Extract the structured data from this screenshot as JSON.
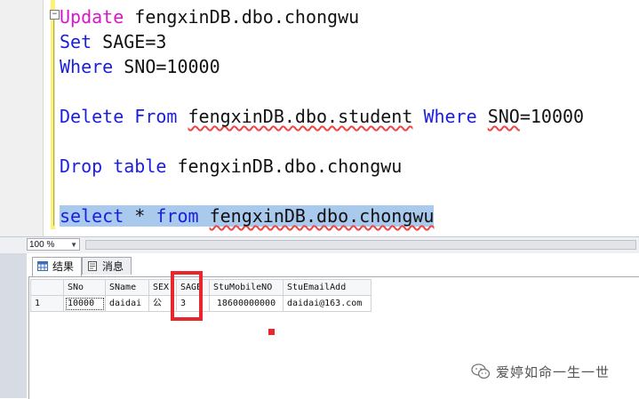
{
  "editor": {
    "lines": [
      {
        "k1": "Update",
        "t1": " fengxinDB.dbo.chongwu"
      },
      {
        "k1": "Set",
        "t1": " SAGE=3"
      },
      {
        "k1": "Where",
        "t1": " SNO=10000"
      },
      {
        "k1": "Delete",
        "t1": " ",
        "k2": "From",
        "t2": " ",
        "sq1": "fengxinDB.dbo.student",
        "t3": " ",
        "k3": "Where",
        "t4": " ",
        "sq2": "SNO",
        "t5": "=10000"
      },
      {
        "k1": "Drop",
        "t1": " ",
        "k2": "table",
        "t2": " fengxinDB.dbo.chongwu"
      },
      {
        "k1": "select",
        "t1": " * ",
        "k2": "from",
        "t2": " ",
        "sq1": "fengxinDB.dbo.chongwu"
      }
    ]
  },
  "zoom": {
    "value": "100 %"
  },
  "tabs": {
    "results": "结果",
    "messages": "消息"
  },
  "grid": {
    "headers": [
      "SNo",
      "SName",
      "SEX",
      "SAGE",
      "StuMobileNO",
      "StuEmailAdd"
    ],
    "rows": [
      {
        "num": "1",
        "cells": [
          "10000",
          "daidai",
          "公",
          "3",
          "18600000000",
          "daidai@163.com"
        ]
      }
    ]
  },
  "watermark": {
    "text": "爱婷如命一生一世"
  },
  "colors": {
    "keyword": "#1a1ee0",
    "keyword_update": "#d916c9",
    "highlight": "#a9c9ed",
    "annotation": "#e8262b"
  }
}
